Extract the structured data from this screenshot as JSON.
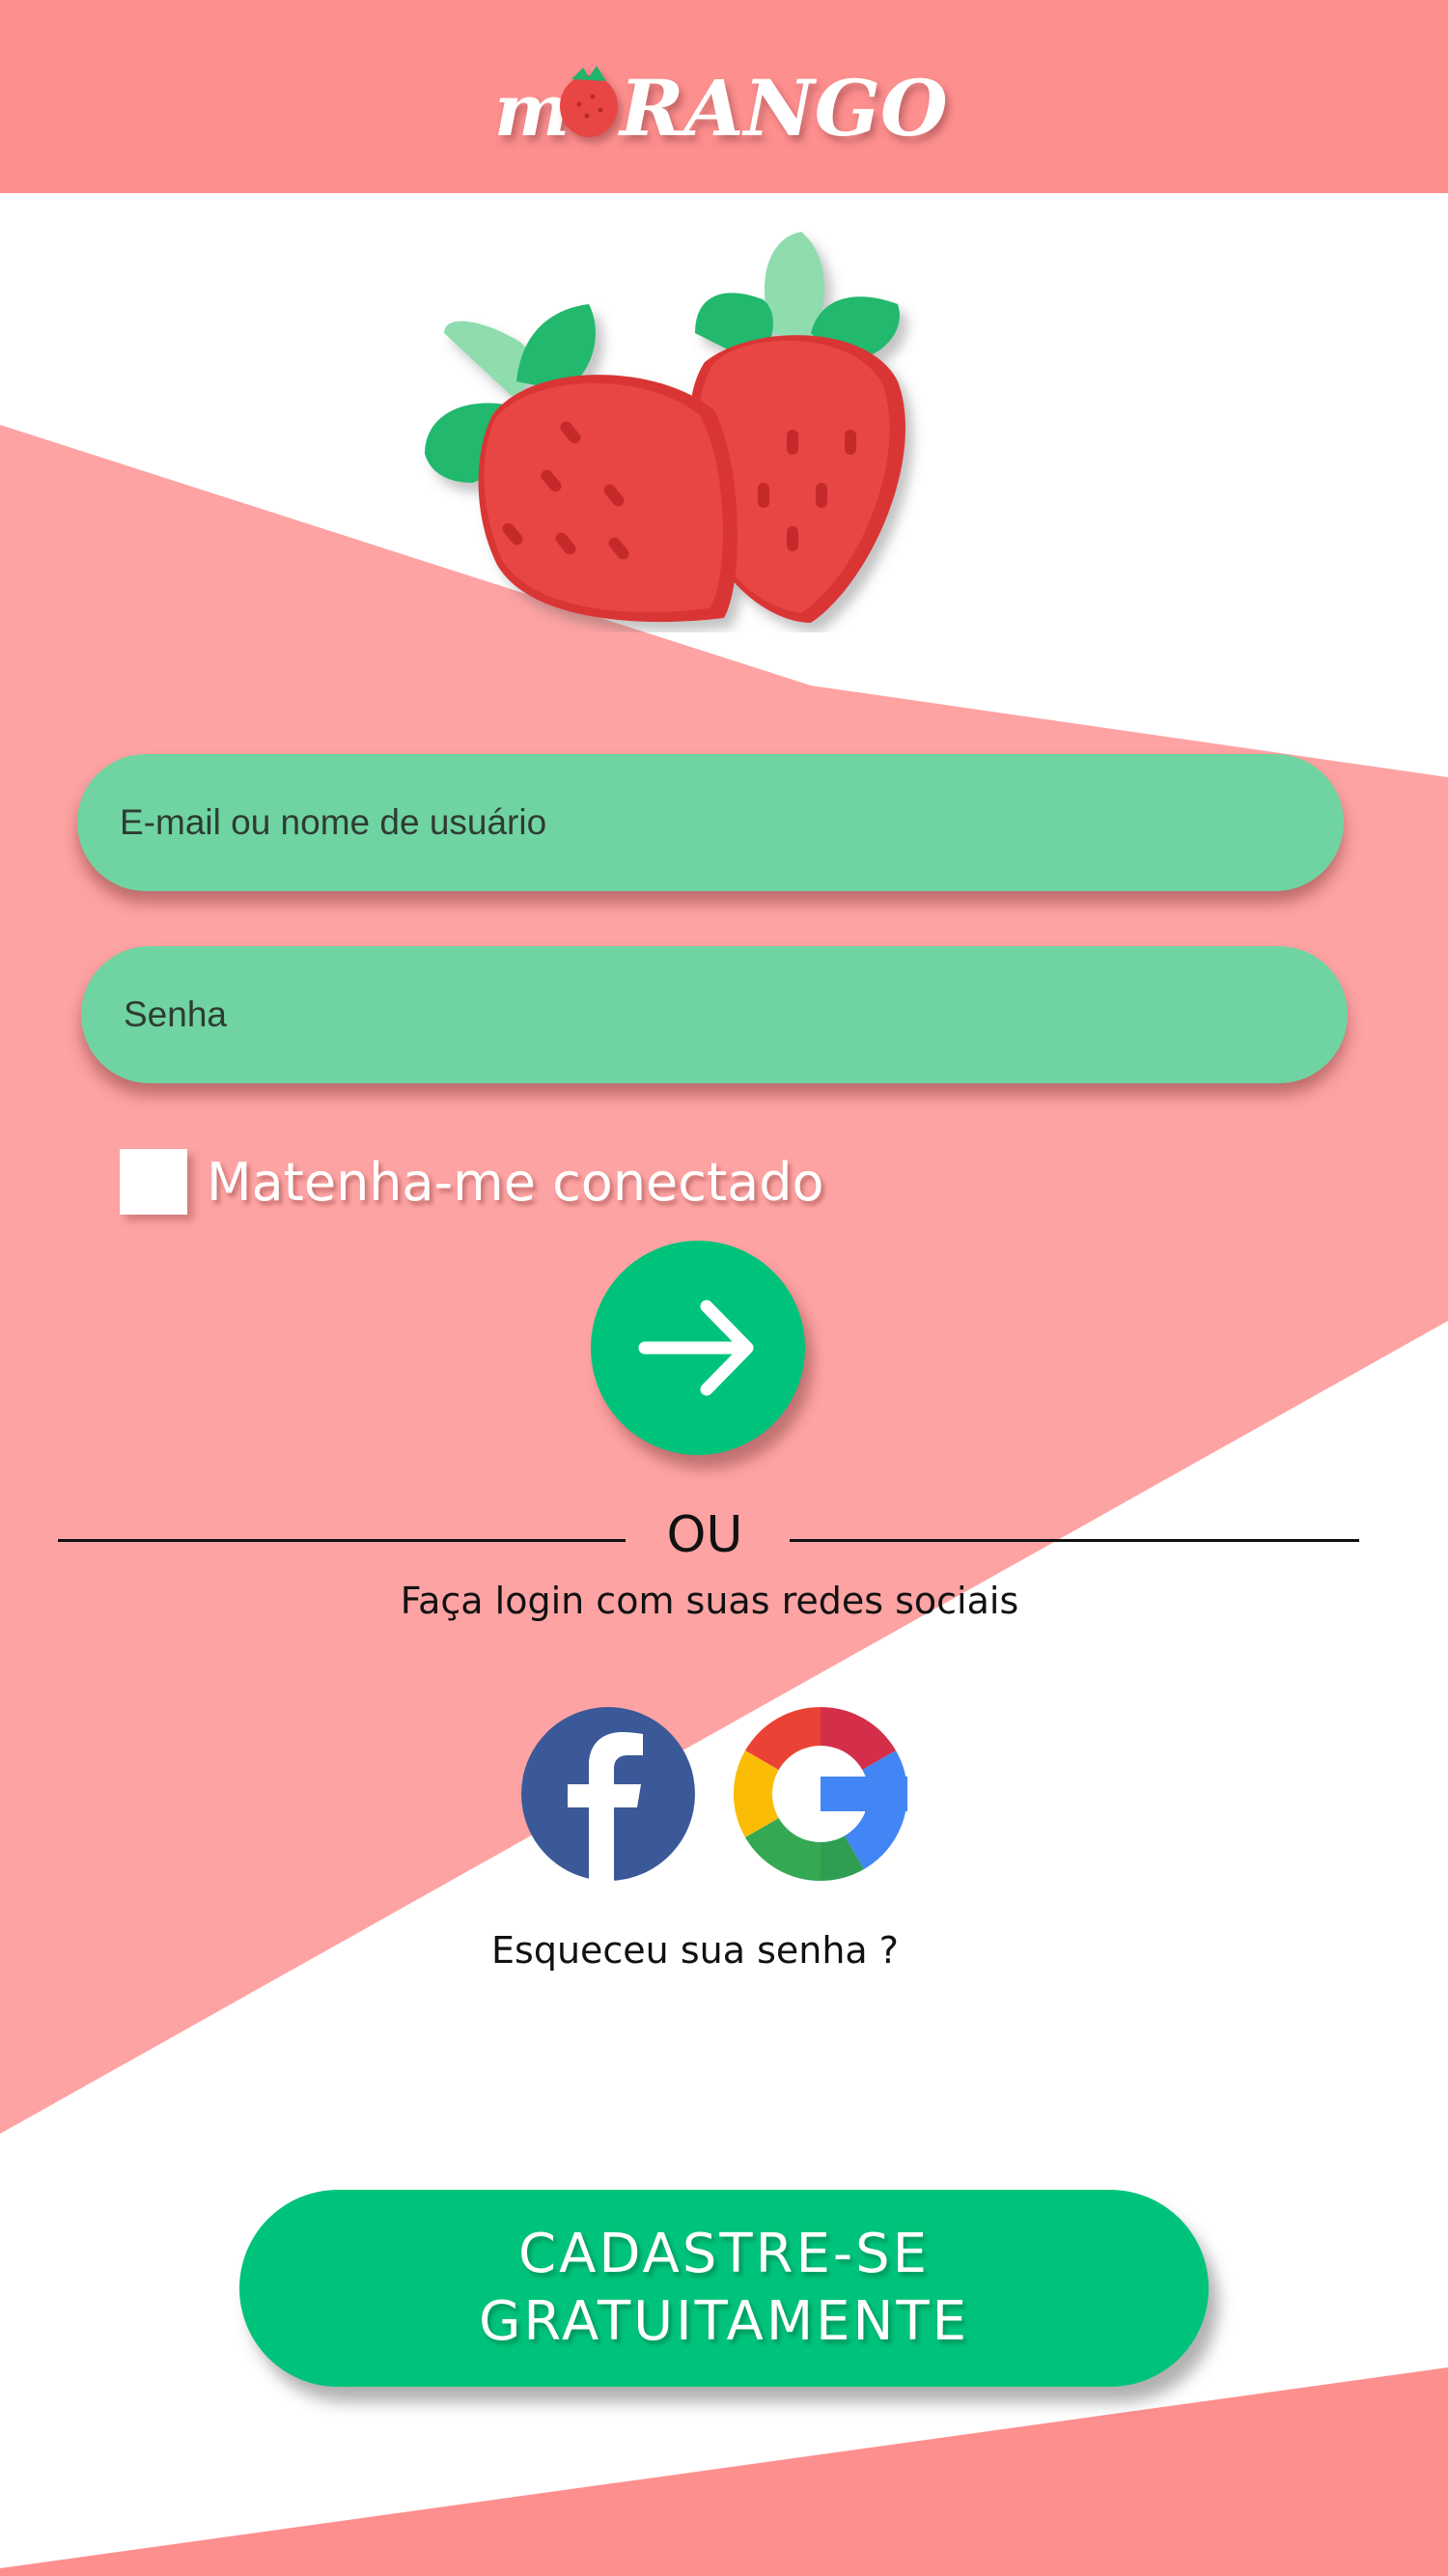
{
  "header": {
    "logo_text_start": "m",
    "logo_text_end": "RANGO",
    "logo_icon": "strawberry-icon",
    "background_color": "#fe8f8f"
  },
  "hero": {
    "icon": "strawberries-illustration"
  },
  "form": {
    "email_placeholder": "E-mail ou nome de usuário",
    "password_placeholder": "Senha",
    "remember_label": "Matenha-me conectado",
    "submit_icon": "arrow-right-icon"
  },
  "divider": {
    "label": "OU"
  },
  "social": {
    "prompt": "Faça login com suas redes sociais",
    "providers": [
      "facebook-icon",
      "google-icon"
    ]
  },
  "forgot_password": "Esqueceu sua senha ?",
  "signup": {
    "line1": "CADASTRE-SE",
    "line2": "GRATUITAMENTE"
  },
  "colors": {
    "pink": "#fe8f8f",
    "pink_light": "#fea3a3",
    "green": "#00c37b",
    "input_green": "#6fd4a1",
    "facebook": "#3b5998"
  }
}
